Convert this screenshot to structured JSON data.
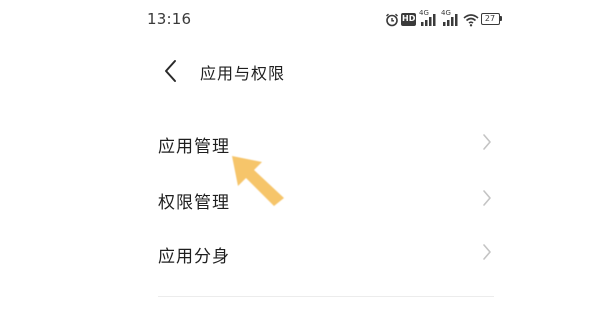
{
  "status_bar": {
    "time": "13:16",
    "icons": [
      "alarm-icon",
      "hd-icon",
      "signal-4g-icon",
      "signal-4g-icon",
      "wifi-icon",
      "battery-icon"
    ],
    "hd_label": "HD",
    "sim1_network": "4G",
    "sim2_network": "4G",
    "battery_level": "27"
  },
  "header": {
    "back_icon": "chevron-left-icon",
    "title": "应用与权限"
  },
  "menu": {
    "items": [
      {
        "label": "应用管理",
        "icon": "chevron-right-icon"
      },
      {
        "label": "权限管理",
        "icon": "chevron-right-icon"
      },
      {
        "label": "应用分身",
        "icon": "chevron-right-icon"
      }
    ]
  },
  "annotation": {
    "icon": "pointer-arrow-icon",
    "color": "#F6C56A"
  }
}
